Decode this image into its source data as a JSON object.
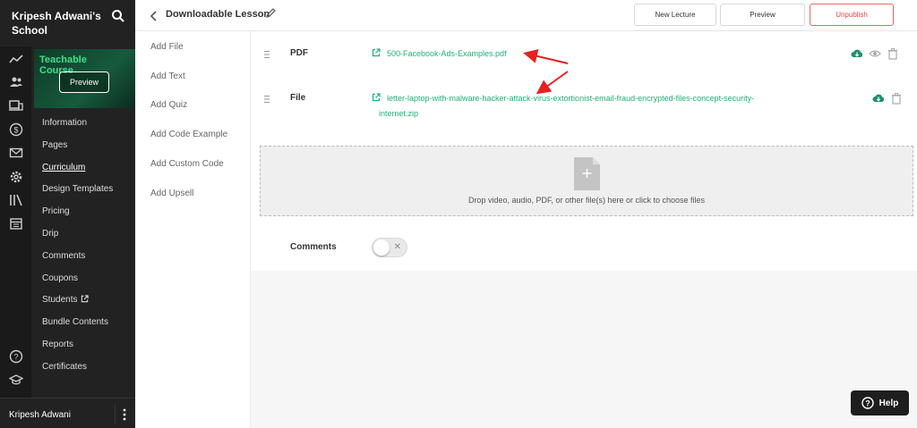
{
  "school": {
    "name": "Kripesh Adwani's School",
    "search_icon": "search-icon"
  },
  "rail_icons": [
    "trending-icon",
    "users-icon",
    "devices-icon",
    "dollar-icon",
    "mail-icon",
    "settings-icon",
    "library-icon",
    "calendar-icon",
    "help-circle-icon",
    "graduation-icon"
  ],
  "course": {
    "thumb_text": "Teachable Course",
    "preview_label": "Preview"
  },
  "menu": [
    {
      "label": "Information"
    },
    {
      "label": "Pages"
    },
    {
      "label": "Curriculum",
      "active": true
    },
    {
      "label": "Design Templates"
    },
    {
      "label": "Pricing"
    },
    {
      "label": "Drip"
    },
    {
      "label": "Comments"
    },
    {
      "label": "Coupons"
    },
    {
      "label": "Students",
      "external": true
    },
    {
      "label": "Bundle Contents"
    },
    {
      "label": "Reports"
    },
    {
      "label": "Certificates"
    }
  ],
  "footer": {
    "user_name": "Kripesh Adwani"
  },
  "topbar": {
    "title": "Downloadable Lesson",
    "new_lecture": "New Lecture",
    "preview": "Preview",
    "unpublish": "Unpublish"
  },
  "add_panel": [
    "Add File",
    "Add Text",
    "Add Quiz",
    "Add Code Example",
    "Add Custom Code",
    "Add Upsell"
  ],
  "files": [
    {
      "label": "PDF",
      "name_lines": [
        "500-Facebook-Ads-Examples.pdf"
      ]
    },
    {
      "label": "File",
      "name_lines": [
        "letter-laptop-with-malware-hacker-attack-virus-extortionist-email-fraud-encrypted-files-concept-security-",
        "internet.zip"
      ]
    }
  ],
  "dropzone": {
    "text": "Drop video, audio, PDF, or other file(s) here or click to choose files"
  },
  "comments": {
    "label": "Comments",
    "enabled": false
  },
  "help": {
    "label": "Help"
  },
  "colors": {
    "accent": "#20b07a",
    "danger": "#e44",
    "sidebar": "#222",
    "arrow": "#e82020"
  }
}
